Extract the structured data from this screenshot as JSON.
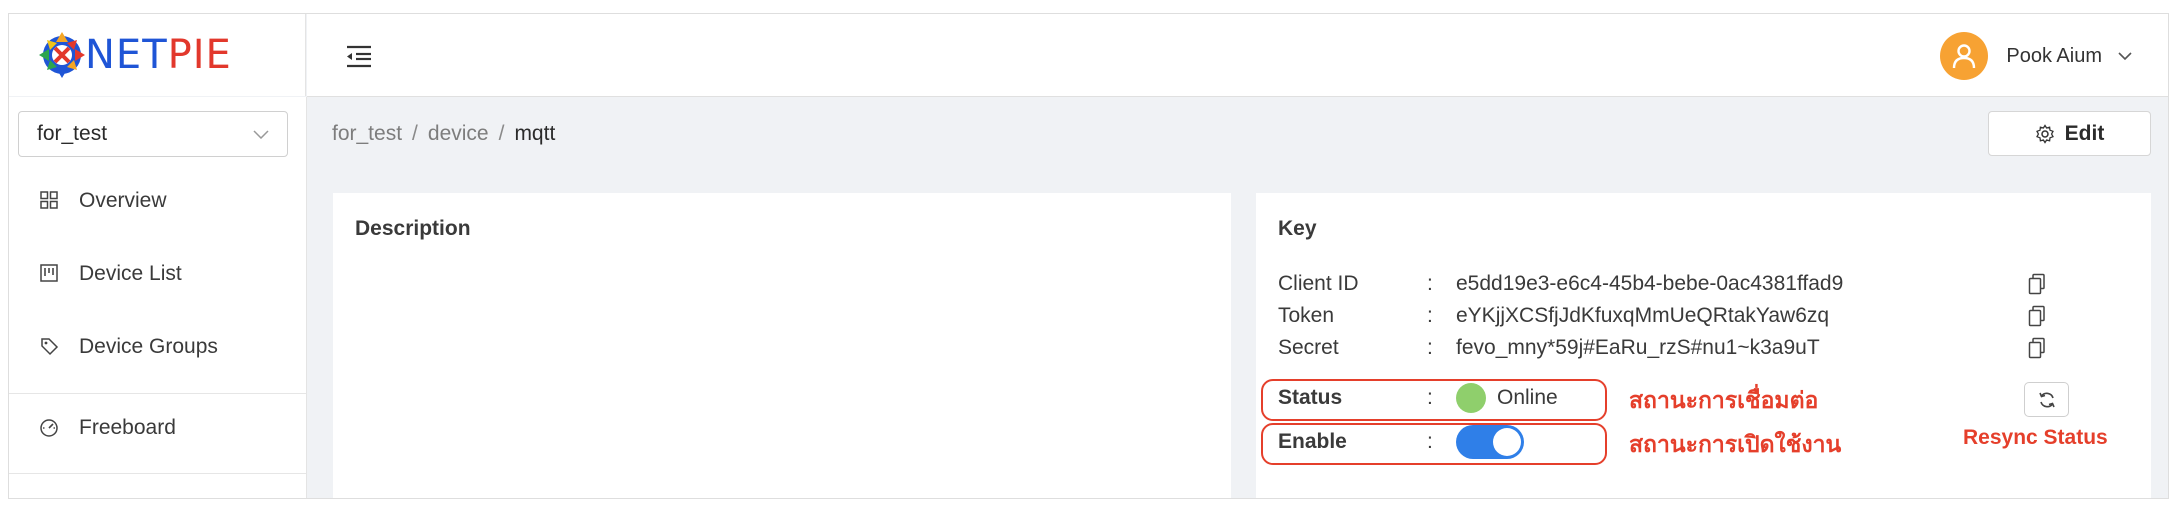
{
  "brand": {
    "net": "NET",
    "pie": "PIE"
  },
  "user": {
    "name": "Pook Aium"
  },
  "sidebar": {
    "project": "for_test",
    "items": [
      {
        "label": "Overview",
        "icon": "grid-icon"
      },
      {
        "label": "Device List",
        "icon": "device-list-icon"
      },
      {
        "label": "Device Groups",
        "icon": "tag-icon"
      },
      {
        "label": "Freeboard",
        "icon": "dashboard-gauge-icon"
      }
    ]
  },
  "breadcrumb": {
    "items": [
      "for_test",
      "device",
      "mqtt"
    ],
    "separator": "/"
  },
  "toolbar": {
    "edit_label": "Edit"
  },
  "description": {
    "title": "Description"
  },
  "key": {
    "title": "Key",
    "colon": ":",
    "client_id": {
      "label": "Client ID",
      "value": "e5dd19e3-e6c4-45b4-bebe-0ac4381ffad9"
    },
    "token": {
      "label": "Token",
      "value": "eYKjjXCSfjJdKfuxqMmUeQRtakYaw6zq"
    },
    "secret": {
      "label": "Secret",
      "value": "fevo_mny*59j#EaRu_rzS#nu1~k3a9uT"
    },
    "status": {
      "label": "Status",
      "value": "Online"
    },
    "enable": {
      "label": "Enable",
      "on": true
    }
  },
  "annotations": {
    "status_th": "สถานะการเชื่อมต่อ",
    "enable_th": "สถานะการเปิดใช้งาน",
    "resync": "Resync Status"
  },
  "colors": {
    "accent": "#2f7fe8",
    "online": "#8fcf6c",
    "annotation": "#e53f2b",
    "avatar": "#f7a233",
    "brand_blue": "#1f55d6",
    "brand_red": "#e2382c"
  }
}
